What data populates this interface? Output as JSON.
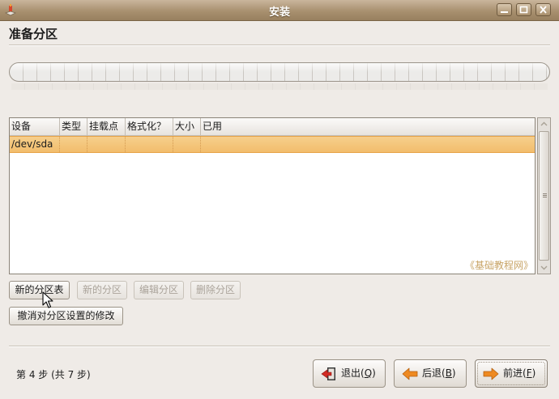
{
  "window": {
    "title": "安装"
  },
  "header": {
    "page_title": "准备分区"
  },
  "progress": {
    "current_step": 4,
    "total_steps": 7,
    "fraction": 0
  },
  "table": {
    "columns": [
      "设备",
      "类型",
      "挂载点",
      "格式化？",
      "大小",
      "已用"
    ],
    "rows": [
      [
        "/dev/sda",
        "",
        "",
        "",
        "",
        ""
      ]
    ],
    "watermark": "《基础教程网》"
  },
  "actions": {
    "new_table": "新的分区表",
    "new_partition": "新的分区",
    "edit_partition": "编辑分区",
    "delete_partition": "删除分区",
    "undo_changes": "撤消对分区设置的修改"
  },
  "footer": {
    "step_text": "第 4 步 (共 7 步)",
    "quit_label": "退出(",
    "quit_key": "Q",
    "back_label": "后退(",
    "back_key": "B",
    "forward_label": "前进(",
    "forward_key": "F",
    "close_paren": ")"
  },
  "colors": {
    "selection": "#f2bd6c",
    "titlebar": "#a8906f",
    "accent_arrow": "#e8801d"
  },
  "icons": {
    "window": "installer-icon",
    "minimize": "minimize-icon",
    "maximize": "maximize-icon",
    "close": "close-icon",
    "quit": "exit-door-icon",
    "back": "arrow-left-icon",
    "forward": "arrow-right-icon"
  }
}
